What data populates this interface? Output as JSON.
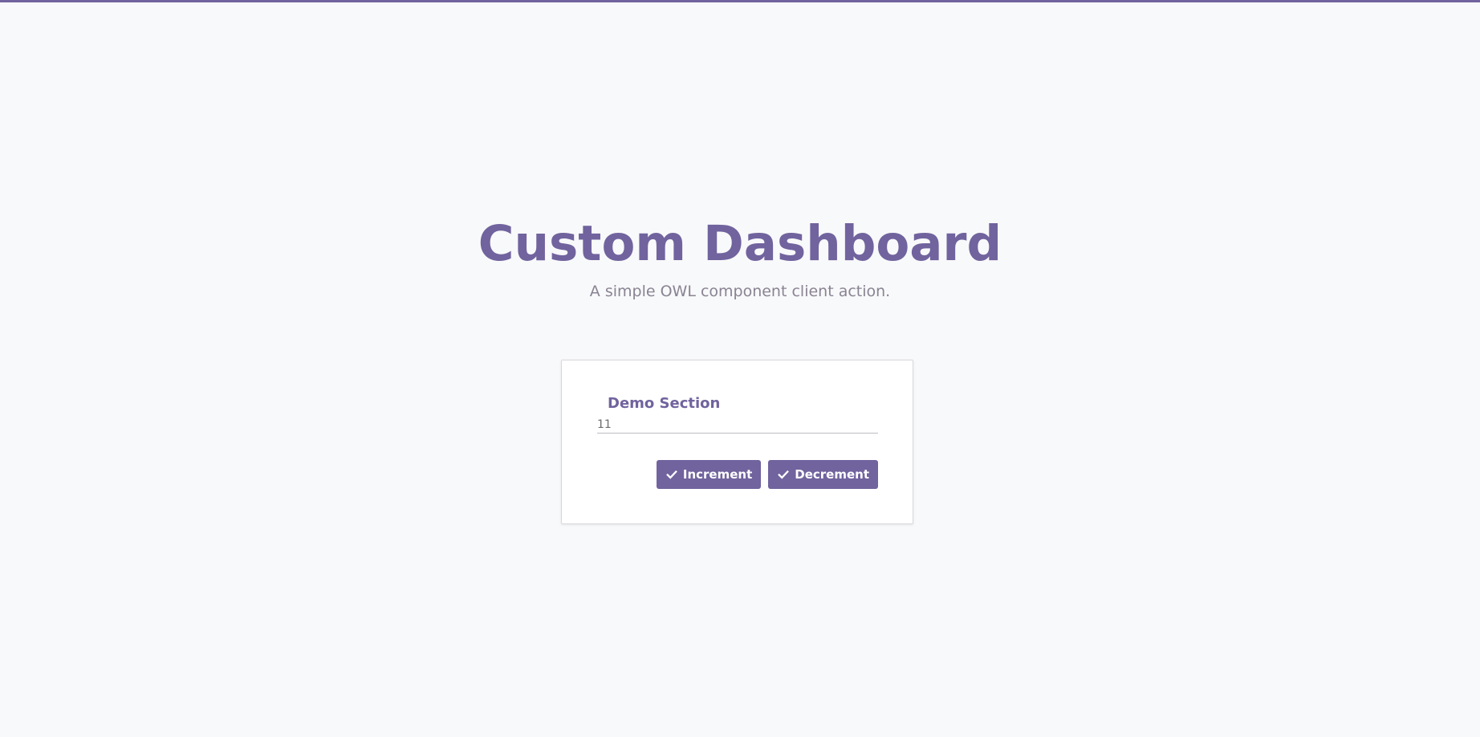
{
  "colors": {
    "accent": "#71639e",
    "background": "#f8f9fa",
    "subtitle": "#8a8393"
  },
  "hero": {
    "title": "Custom Dashboard",
    "subtitle": "A simple OWL component client action."
  },
  "card": {
    "section_title": "Demo Section",
    "counter_value": "11",
    "buttons": [
      {
        "label": "Increment",
        "icon": "check-icon"
      },
      {
        "label": "Decrement",
        "icon": "check-icon"
      }
    ]
  }
}
